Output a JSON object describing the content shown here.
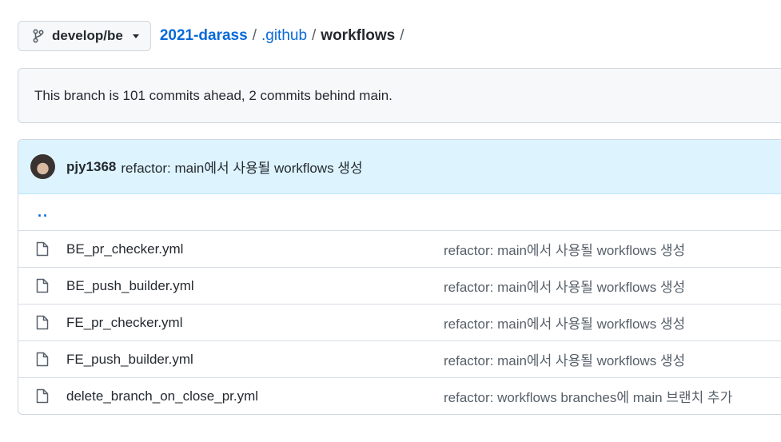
{
  "branch": {
    "name": "develop/be",
    "icon": "git-branch-icon"
  },
  "breadcrumb": {
    "repo": "2021-darass",
    "separator": "/",
    "folder": ".github",
    "current": "workflows"
  },
  "notice": {
    "text": "This branch is 101 commits ahead, 2 commits behind main."
  },
  "latest_commit": {
    "author": "pjy1368",
    "message": "refactor: main에서 사용될 workflows 생성"
  },
  "parent_link": "..",
  "files": [
    {
      "name": "BE_pr_checker.yml",
      "commit": "refactor: main에서 사용될 workflows 생성"
    },
    {
      "name": "BE_push_builder.yml",
      "commit": "refactor: main에서 사용될 workflows 생성"
    },
    {
      "name": "FE_pr_checker.yml",
      "commit": "refactor: main에서 사용될 workflows 생성"
    },
    {
      "name": "FE_push_builder.yml",
      "commit": "refactor: main에서 사용될 workflows 생성"
    },
    {
      "name": "delete_branch_on_close_pr.yml",
      "commit": "refactor: workflows branches에 main 브랜치 추가"
    }
  ],
  "colors": {
    "link": "#0969da",
    "header_bg": "#ddf4ff",
    "muted": "#57606a"
  }
}
